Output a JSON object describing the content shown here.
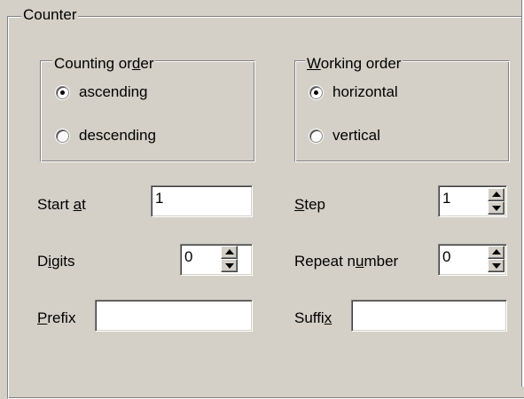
{
  "counter": {
    "title": "Counter",
    "counting_order": {
      "title_pre": "Counting or",
      "title_key": "d",
      "title_post": "er",
      "options": [
        {
          "label": "ascending",
          "checked": true
        },
        {
          "label": "descending",
          "checked": false
        }
      ]
    },
    "working_order": {
      "title_key": "W",
      "title_post": "orking order",
      "options": [
        {
          "label": "horizontal",
          "checked": true
        },
        {
          "label": "vertical",
          "checked": false
        }
      ]
    },
    "start_at": {
      "label_pre": "Start ",
      "label_key": "a",
      "label_post": "t",
      "value": "1"
    },
    "step": {
      "label_key": "S",
      "label_post": "tep",
      "value": "1"
    },
    "digits": {
      "label_pre": "D",
      "label_key": "i",
      "label_post": "gits",
      "value": "0"
    },
    "repeat_number": {
      "label_pre": "Repeat n",
      "label_key": "u",
      "label_post": "mber",
      "value": "0"
    },
    "prefix": {
      "label_key": "P",
      "label_post": "refix",
      "value": ""
    },
    "suffix": {
      "label_pre": "Suffi",
      "label_key": "x",
      "value": ""
    },
    "icons": {
      "spin_up": "spin-up-arrow-icon",
      "spin_down": "spin-down-arrow-icon"
    }
  }
}
